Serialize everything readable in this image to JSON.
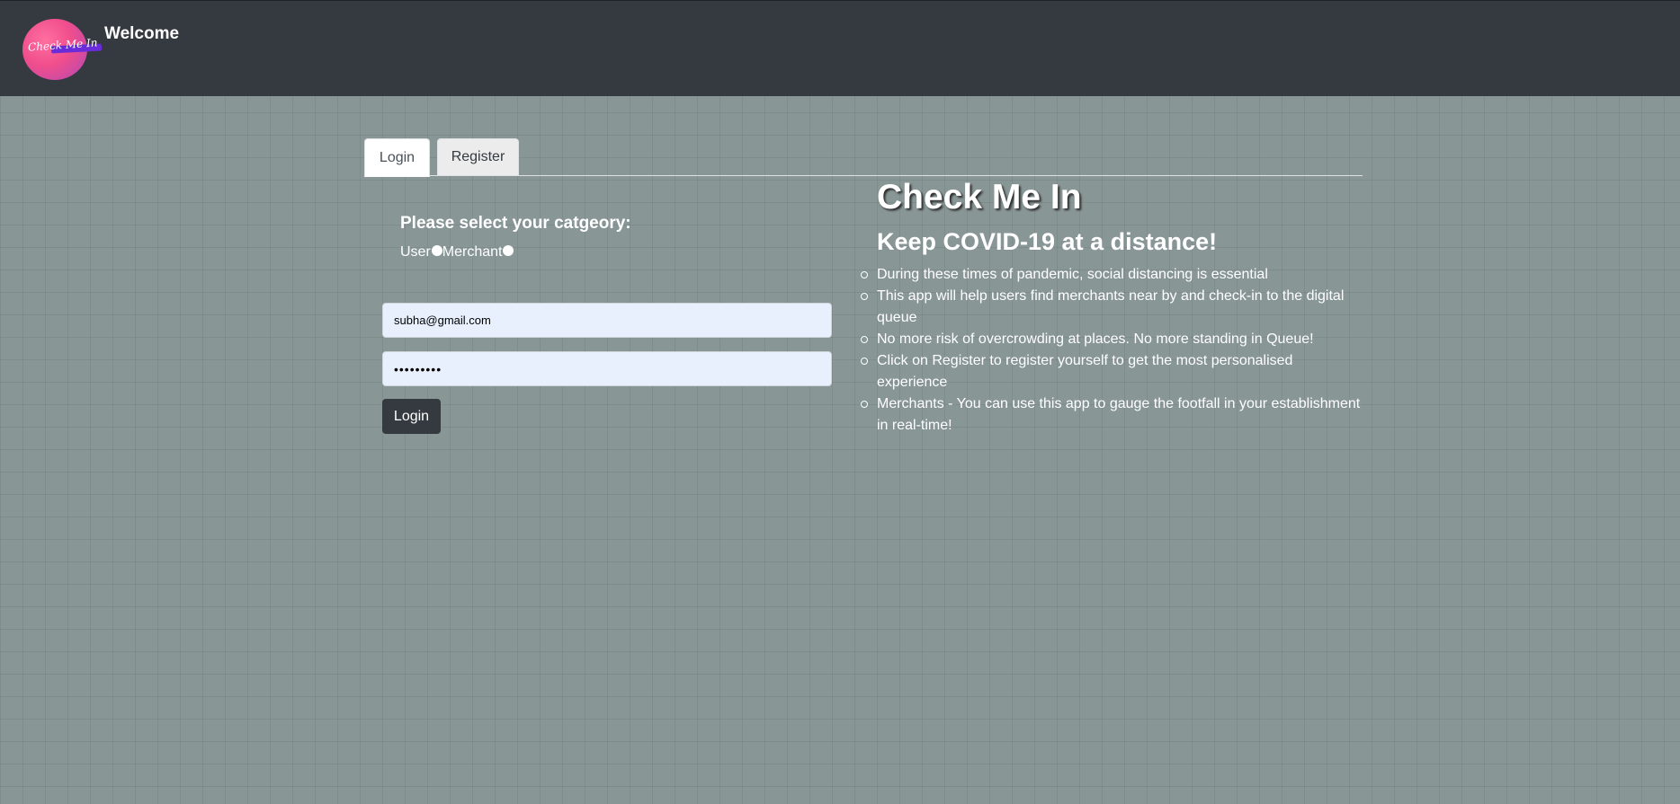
{
  "navbar": {
    "brand": "Welcome",
    "logo_text": "Check Me In",
    "logo_icon": "check-me-in-logo"
  },
  "tabs": [
    {
      "label": "Login",
      "active": true
    },
    {
      "label": "Register",
      "active": false
    }
  ],
  "login_form": {
    "category_heading": "Please select your catgeory:",
    "category_options": [
      "User",
      "Merchant"
    ],
    "email_value": "subha@gmail.com",
    "password_value": "•••••••••",
    "submit_label": "Login"
  },
  "hero": {
    "title": "Check Me In",
    "subtitle": "Keep COVID-19 at a distance!",
    "points": [
      "During these times of pandemic, social distancing is essential",
      "This app will help users find merchants near by and check-in to the digital queue",
      "No more risk of overcrowding at places. No more standing in Queue!",
      "Click on Register to register yourself to get the most personalised experience",
      "Merchants - You can use this app to gauge the footfall in your establishment in real-time!"
    ]
  },
  "colors": {
    "navbar": "#343a40",
    "background": "#899696",
    "input_fill": "#e8f0fe",
    "button": "#343a40"
  }
}
